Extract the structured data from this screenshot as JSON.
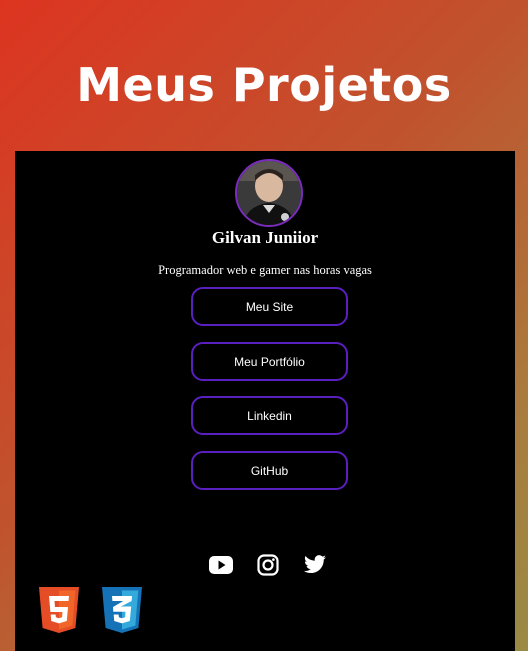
{
  "header": {
    "title": "Meus Projetos"
  },
  "profile": {
    "name": "Gilvan Juniior",
    "bio": "Programador web e gamer nas horas vagas"
  },
  "links": [
    {
      "label": "Meu Site"
    },
    {
      "label": "Meu Portfólio"
    },
    {
      "label": "Linkedin"
    },
    {
      "label": "GitHub"
    }
  ],
  "social": [
    {
      "icon": "youtube-icon"
    },
    {
      "icon": "instagram-icon"
    },
    {
      "icon": "twitter-icon"
    }
  ],
  "tech_badges": [
    {
      "icon": "html5-logo",
      "text": "5",
      "color": "#e44d26"
    },
    {
      "icon": "css3-logo",
      "text": "3",
      "color": "#1572b6"
    }
  ],
  "colors": {
    "background_start": "#dd3420",
    "background_end": "#9a8a45",
    "card": "#000000",
    "button_border": "#5a1fbf",
    "avatar_border": "#7b2cbf"
  }
}
